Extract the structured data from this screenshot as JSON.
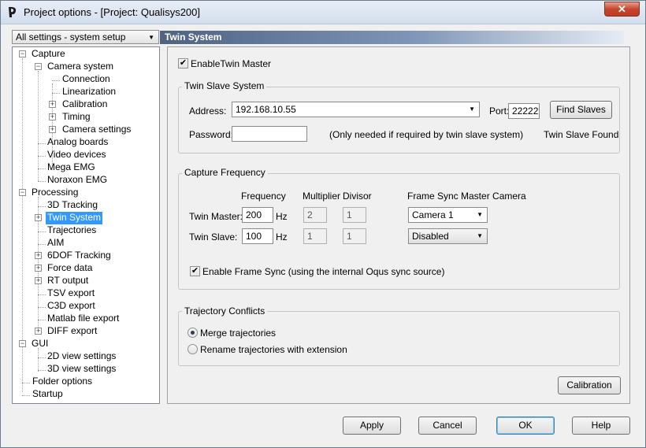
{
  "window": {
    "title": "Project options - [Project: Qualisys200]",
    "close_label": "✕"
  },
  "settings_selector": {
    "value": "All settings - system setup"
  },
  "tree": {
    "capture": "Capture",
    "camera_system": "Camera system",
    "connection": "Connection",
    "linearization": "Linearization",
    "calibration": "Calibration",
    "timing": "Timing",
    "camera_settings": "Camera settings",
    "analog_boards": "Analog boards",
    "video_devices": "Video devices",
    "mega_emg": "Mega EMG",
    "noraxon_emg": "Noraxon EMG",
    "processing": "Processing",
    "tracking_3d": "3D Tracking",
    "twin_system": "Twin System",
    "trajectories": "Trajectories",
    "aim": "AIM",
    "tracking_6dof": "6DOF Tracking",
    "force_data": "Force data",
    "rt_output": "RT output",
    "tsv_export": "TSV export",
    "c3d_export": "C3D export",
    "matlab_export": "Matlab file export",
    "diff_export": "DIFF export",
    "gui": "GUI",
    "view_2d": "2D view settings",
    "view_3d": "3D view settings",
    "folder_options": "Folder options",
    "startup": "Startup"
  },
  "panel": {
    "header": "Twin System",
    "enable_twin_master": {
      "label": "EnableTwin Master",
      "checked": true
    },
    "slave_group": {
      "title": "Twin Slave System",
      "address_label": "Address:",
      "address_value": "192.168.10.55",
      "port_label": "Port:",
      "port_value": "22222",
      "find_slaves": "Find Slaves",
      "password_label": "Password:",
      "password_value": "",
      "password_note": "(Only needed if required by twin slave system)",
      "status": "Twin Slave Found"
    },
    "frequency_group": {
      "title": "Capture Frequency",
      "col_frequency": "Frequency",
      "col_multiplier": "Multiplier",
      "col_divisor": "Divisor",
      "col_sync_camera": "Frame Sync Master Camera",
      "master_label": "Twin Master:",
      "master_frequency": "200",
      "master_unit": "Hz",
      "master_multiplier": "2",
      "master_divisor": "1",
      "master_camera": "Camera 1",
      "slave_label": "Twin Slave:",
      "slave_frequency": "100",
      "slave_unit": "Hz",
      "slave_multiplier": "1",
      "slave_divisor": "1",
      "slave_camera": "Disabled",
      "frame_sync": {
        "label": "Enable Frame Sync (using the internal Oqus sync source)",
        "checked": true
      }
    },
    "conflicts_group": {
      "title": "Trajectory Conflicts",
      "merge": {
        "label": "Merge trajectories",
        "selected": true
      },
      "rename": {
        "label": "Rename trajectories with extension",
        "selected": false
      }
    },
    "calibration_button": "Calibration"
  },
  "footer": {
    "apply": "Apply",
    "cancel": "Cancel",
    "ok": "OK",
    "help": "Help"
  },
  "icons": {
    "expander_collapsed": "plus-box-icon",
    "expander_expanded": "minus-box-icon",
    "dropdown": "chevron-down-icon",
    "check": "check-icon"
  },
  "colors": {
    "selection": "#3399ff",
    "header_gradient_start": "#4f6381",
    "close_button": "#c7462e"
  }
}
